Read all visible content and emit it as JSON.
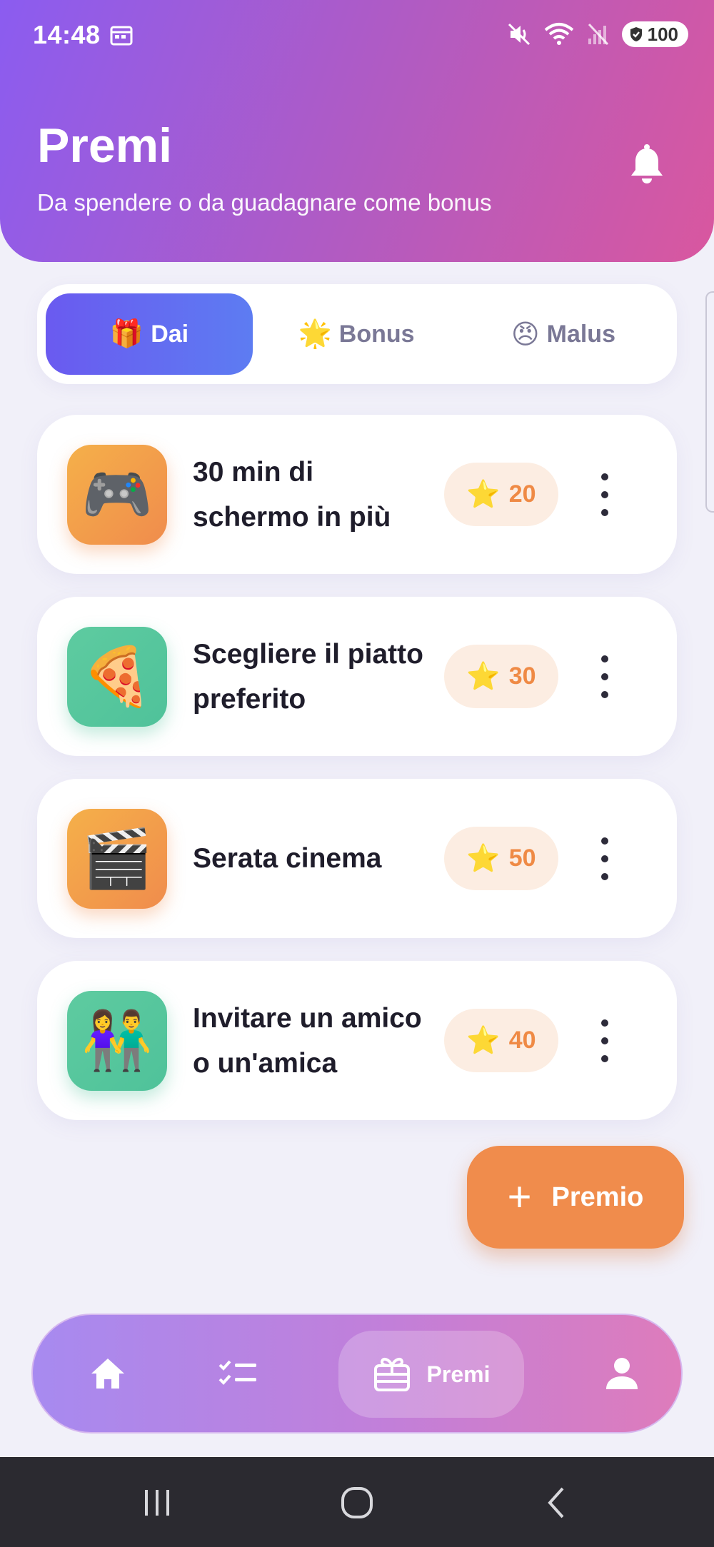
{
  "status_bar": {
    "time": "14:48",
    "battery": "100",
    "icons": [
      "calendar-icon",
      "mute-icon",
      "wifi-icon",
      "no-signal-icon",
      "battery-icon"
    ]
  },
  "header": {
    "title": "Premi",
    "subtitle": "Da spendere o da guadagnare come bonus",
    "bell_icon": "bell-icon"
  },
  "tabs": [
    {
      "emoji": "🎁",
      "label": "Dai",
      "active": true
    },
    {
      "emoji": "🌟",
      "label": "Bonus",
      "active": false
    },
    {
      "emoji": "😠",
      "label": "Malus",
      "active": false
    }
  ],
  "rewards": [
    {
      "emoji": "🎮",
      "title": "30 min di schermo in più",
      "points": "20",
      "color": "orange"
    },
    {
      "emoji": "🍕",
      "title": "Scegliere il piatto preferito",
      "points": "30",
      "color": "green"
    },
    {
      "emoji": "🎬",
      "title": "Serata cinema",
      "points": "50",
      "color": "orange"
    },
    {
      "emoji": "👫",
      "title": "Invitare un amico o un'amica",
      "points": "40",
      "color": "green"
    }
  ],
  "fab": {
    "plus": "+",
    "label": "Premio"
  },
  "bottom_nav": {
    "items": [
      {
        "icon": "home-icon"
      },
      {
        "icon": "checklist-icon"
      },
      {
        "icon": "gift-icon",
        "label": "Premi",
        "active": true
      },
      {
        "icon": "user-icon"
      }
    ]
  },
  "colors": {
    "header_start": "#8b5cf0",
    "header_end": "#d9579f",
    "accent_orange": "#f08c4c",
    "tab_active": "#6a5af0",
    "points_bg": "#fcede2",
    "background": "#f1f0f9"
  },
  "system_nav": {
    "icons": [
      "recent-apps-icon",
      "home-circle-icon",
      "back-icon"
    ]
  }
}
